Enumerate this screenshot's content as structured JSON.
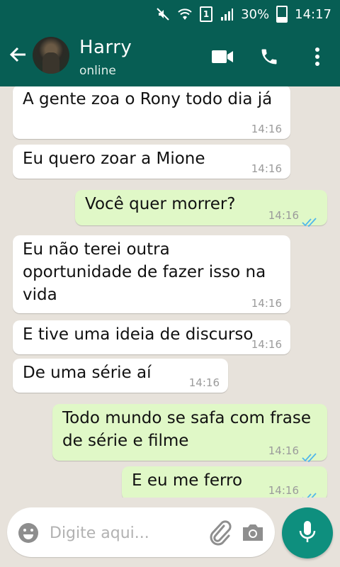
{
  "status_bar": {
    "battery_percent": "30%",
    "time": "14:17",
    "sim": "1"
  },
  "header": {
    "contact_name": "Harry",
    "contact_status": "online"
  },
  "messages": [
    {
      "direction": "in",
      "text": "A gente zoa o Rony todo dia já",
      "time": "14:16"
    },
    {
      "direction": "in",
      "text": "Eu quero zoar a Mione",
      "time": "14:16"
    },
    {
      "direction": "out",
      "text": "Você quer morrer?",
      "time": "14:16",
      "status": "read"
    },
    {
      "direction": "in",
      "text": "Eu não terei outra oportunidade de fazer isso na vida",
      "time": "14:16"
    },
    {
      "direction": "in",
      "text": "E tive uma ideia de discurso",
      "time": "14:16"
    },
    {
      "direction": "in",
      "text": "De uma série aí",
      "time": "14:16"
    },
    {
      "direction": "out",
      "text": "Todo mundo se safa com frase de série e filme",
      "time": "14:16",
      "status": "read"
    },
    {
      "direction": "out",
      "text": "E eu me ferro",
      "time": "14:16",
      "status": "read"
    }
  ],
  "composer": {
    "placeholder": "Digite aqui..."
  },
  "colors": {
    "header": "#075e54",
    "outgoing_bubble": "#e0f8c7",
    "incoming_bubble": "#ffffff",
    "read_ticks": "#4fb6ec",
    "mic_button": "#0e8f7e"
  }
}
